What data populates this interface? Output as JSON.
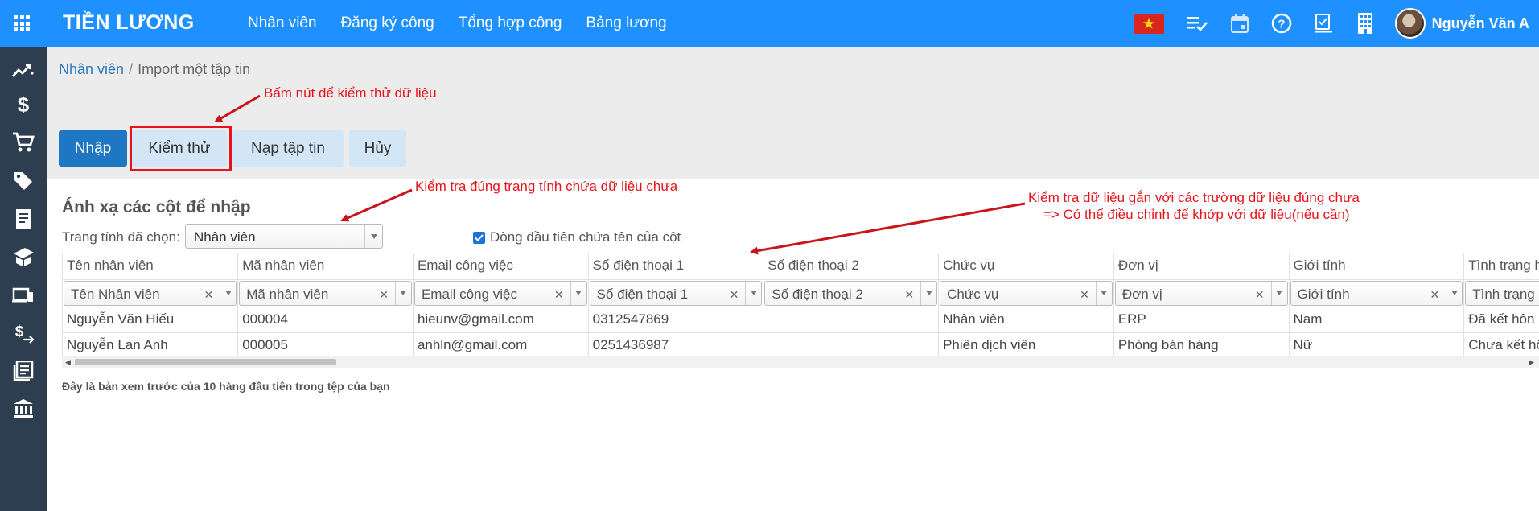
{
  "app": {
    "title": "TIỀN LƯƠNG"
  },
  "topnav": [
    "Nhân viên",
    "Đăng ký công",
    "Tổng hợp công",
    "Bảng lương"
  ],
  "user": {
    "name": "Nguyễn Văn A"
  },
  "sidebar": {
    "icons": [
      "trending-icon",
      "dollar-icon",
      "cart-icon",
      "tag-icon",
      "receipt-icon",
      "school-icon",
      "devices-icon",
      "money-exchange-icon",
      "news-icon",
      "bank-icon"
    ]
  },
  "breadcrumb": {
    "parent": "Nhân viên",
    "separator": "/",
    "current": "Import một tập tin"
  },
  "buttons": {
    "import": "Nhập",
    "test": "Kiểm thử",
    "load": "Nạp tập tin",
    "cancel": "Hủy"
  },
  "mapping": {
    "title": "Ánh xạ các cột để nhập",
    "sheet_label": "Trang tính đã chọn:",
    "sheet_value": "Nhân viên",
    "header_checkbox_label": "Dòng đầu tiên chứa tên của cột",
    "header_checkbox_checked": true
  },
  "grid": {
    "headers": [
      "Tên nhân viên",
      "Mã nhân viên",
      "Email công việc",
      "Số điện thoại 1",
      "Số điện thoại 2",
      "Chức vụ",
      "Đơn vị",
      "Giới tính",
      "Tình trạng hôn nhân"
    ],
    "field_selects": [
      "Tên Nhân viên",
      "Mã nhân viên",
      "Email công việc",
      "Số điện thoại 1",
      "Số điện thoại 2",
      "Chức vụ",
      "Đơn vị",
      "Giới tính",
      "Tình trạng hôn nhân"
    ],
    "rows": [
      [
        "Nguyễn Văn Hiếu",
        "000004",
        "hieunv@gmail.com",
        "0312547869",
        "",
        "Nhân viên",
        "ERP",
        "Nam",
        "Đã kết hôn"
      ],
      [
        "Nguyễn Lan Anh",
        "000005",
        "anhln@gmail.com",
        "0251436987",
        "",
        "Phiên dịch viên",
        "Phòng bán hàng",
        "Nữ",
        "Chưa kết hôn"
      ]
    ],
    "scroll_fraction": 0.18
  },
  "preview_note": "Đây là bản xem trước của 10 hàng đầu tiên trong tệp của bạn",
  "annotations": {
    "test_button": "Bấm nút để kiểm thử dữ liệu",
    "sheet": "Kiểm tra đúng trang tính chứa dữ liệu chưa",
    "fields_line1": "Kiểm tra dữ liệu gắn với các trường dữ liệu đúng chưa",
    "fields_line2": "=> Có thể điều chỉnh để khớp với dữ liệu(nếu cần)"
  },
  "colors": {
    "topbar": "#1e90ff",
    "sidebar": "#2c3e50",
    "primary_button": "#1f77c4",
    "secondary_button": "#d3e6f5",
    "annotation": "#e8131a"
  }
}
